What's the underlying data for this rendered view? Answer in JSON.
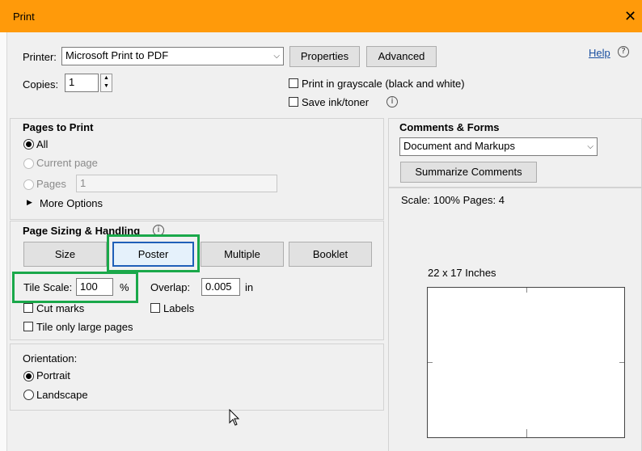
{
  "window": {
    "title": "Print",
    "close_glyph": "✕"
  },
  "top": {
    "printer_label": "Printer:",
    "printer_value": "Microsoft Print to PDF",
    "properties_label": "Properties",
    "advanced_label": "Advanced",
    "help_label": "Help",
    "copies_label": "Copies:",
    "copies_value": "1",
    "grayscale_label": "Print in grayscale (black and white)",
    "save_ink_label": "Save ink/toner"
  },
  "pages_to_print": {
    "heading": "Pages to Print",
    "all_label": "All",
    "current_label": "Current page",
    "pages_label": "Pages",
    "pages_value": "1",
    "more_options_label": "More Options"
  },
  "page_sizing": {
    "heading": "Page Sizing & Handling",
    "tabs": [
      {
        "label": "Size"
      },
      {
        "label": "Poster"
      },
      {
        "label": "Multiple"
      },
      {
        "label": "Booklet"
      }
    ],
    "selected_tab": "Poster",
    "tile_scale_label": "Tile Scale:",
    "tile_scale_value": "100",
    "tile_scale_unit": "%",
    "overlap_label": "Overlap:",
    "overlap_value": "0.005",
    "overlap_unit": "in",
    "cut_marks_label": "Cut marks",
    "labels_label": "Labels",
    "tile_large_label": "Tile only large pages"
  },
  "orientation": {
    "heading": "Orientation:",
    "portrait_label": "Portrait",
    "landscape_label": "Landscape",
    "selected": "Portrait"
  },
  "comments_forms": {
    "heading": "Comments & Forms",
    "value": "Document and Markups",
    "summarize_label": "Summarize Comments"
  },
  "preview": {
    "scale_text": "Scale: 100% Pages: 4",
    "size_text": "22 x 17 Inches"
  },
  "colors": {
    "titlebar": "#ff9a0a",
    "highlight": "#1aa84a",
    "selected_border": "#1f5fb8"
  }
}
